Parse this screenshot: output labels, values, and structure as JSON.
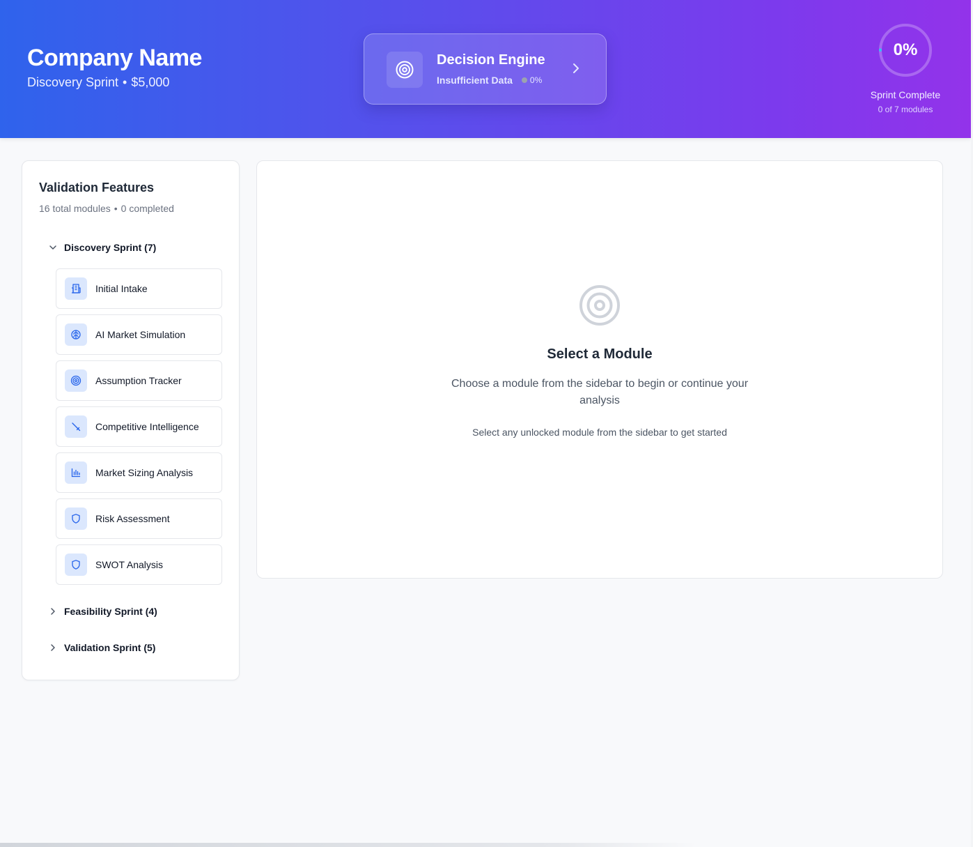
{
  "header": {
    "company_name": "Company Name",
    "sprint_name": "Discovery Sprint",
    "separator": "•",
    "price": "$5,000",
    "gradient": [
      "#2f63ec",
      "#9333ea"
    ]
  },
  "decision_engine": {
    "title": "Decision Engine",
    "status": "Insufficient Data",
    "percent": "0%",
    "icon": "target-icon"
  },
  "sprint_progress": {
    "percent_label": "0%",
    "value": 0,
    "label": "Sprint Complete",
    "count": "0 of 7 modules"
  },
  "sidebar": {
    "title": "Validation Features",
    "total": "16 total modules",
    "separator": "•",
    "completed": "0 completed",
    "groups": [
      {
        "label": "Discovery Sprint (7)",
        "expanded": true,
        "modules": [
          {
            "label": "Initial Intake",
            "icon": "building-icon"
          },
          {
            "label": "AI Market Simulation",
            "icon": "brain-icon"
          },
          {
            "label": "Assumption Tracker",
            "icon": "target-icon"
          },
          {
            "label": "Competitive Intelligence",
            "icon": "sword-icon"
          },
          {
            "label": "Market Sizing Analysis",
            "icon": "bar-chart-icon"
          },
          {
            "label": "Risk Assessment",
            "icon": "shield-icon"
          },
          {
            "label": "SWOT Analysis",
            "icon": "shield-icon"
          }
        ]
      },
      {
        "label": "Feasibility Sprint (4)",
        "expanded": false
      },
      {
        "label": "Validation Sprint (5)",
        "expanded": false
      }
    ]
  },
  "main": {
    "icon": "target-icon",
    "title": "Select a Module",
    "description": "Choose a module from the sidebar to begin or continue your analysis",
    "hint": "Select any unlocked module from the sidebar to get started"
  },
  "colors": {
    "accent": "#2563eb",
    "icon_bg": "#dbe7fd"
  }
}
